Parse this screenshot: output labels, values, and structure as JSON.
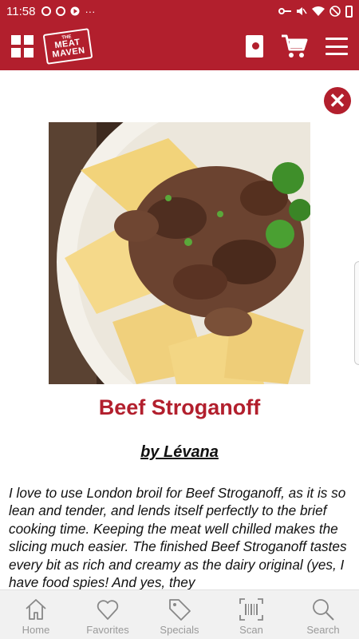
{
  "status_bar": {
    "time": "11:58",
    "notification_icons": [
      "settings-icon",
      "pinterest-icon",
      "play-icon",
      "more-dots"
    ],
    "system_icons": [
      "key-icon",
      "mute-icon",
      "wifi-icon",
      "dnd-icon",
      "battery-icon"
    ]
  },
  "app_bar": {
    "logo": {
      "line1": "THE",
      "line2": "MEAT",
      "line3": "MAVEN"
    }
  },
  "recipe": {
    "title": "Beef Stroganoff",
    "author": "by Lévana",
    "description": "I love to use London broil for Beef Stroganoff, as it is so lean and tender, and lends itself perfectly to the brief cooking time. Keeping the meat well chilled makes the slicing much easier. The finished Beef Stroganoff tastes every bit as rich and creamy as the dairy original (yes, I have food spies! And yes, they"
  },
  "bottom_nav": [
    {
      "label": "Home",
      "icon": "home-icon"
    },
    {
      "label": "Favorites",
      "icon": "heart-icon"
    },
    {
      "label": "Specials",
      "icon": "tag-icon"
    },
    {
      "label": "Scan",
      "icon": "barcode-icon"
    },
    {
      "label": "Search",
      "icon": "search-icon"
    }
  ],
  "colors": {
    "brand": "#b21f2d",
    "nav_inactive": "#999999",
    "title": "#b21f2d"
  }
}
